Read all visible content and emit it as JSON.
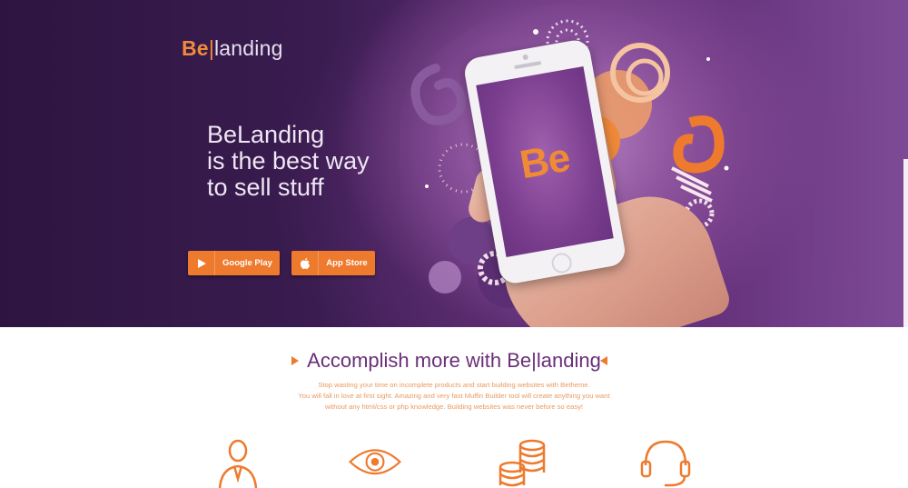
{
  "brand": {
    "logo_be": "Be",
    "logo_sep": "|",
    "logo_rest": "landing",
    "accent_color": "#ee7a2e",
    "purple_color": "#6a2f78"
  },
  "hero": {
    "headline_lines": [
      "BeLanding",
      "is the best way",
      "to sell stuff"
    ],
    "buttons": [
      {
        "label": "Google Play",
        "icon": "play-store-icon"
      },
      {
        "label": "App Store",
        "icon": "apple-icon"
      }
    ],
    "phone_screen_logo": "Be"
  },
  "features": {
    "title": "Accomplish more with Be|landing",
    "description_lines": [
      "Stop wasting your time on incomplete products and start building websites with Betheme.",
      "You will fall in love at first sight. Amazing and very fast Muffin Builder tool will create anything you want",
      "without any html/css or php knowledge. Building websites was never before so easy!"
    ],
    "icons": [
      "businessman-icon",
      "eye-icon",
      "coins-icon",
      "headset-icon"
    ]
  }
}
